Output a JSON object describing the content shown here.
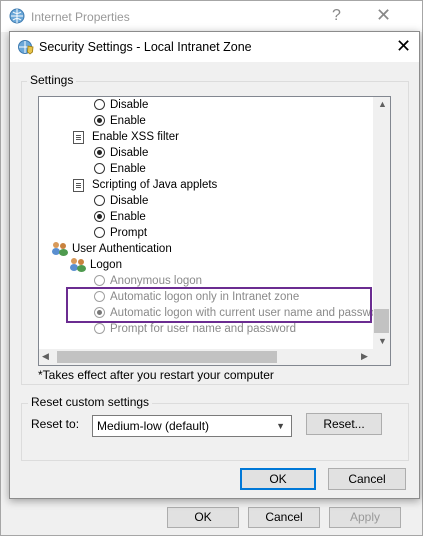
{
  "background_window": {
    "title": "Internet Properties",
    "help_label": "?",
    "close_label": "✕",
    "ok_label": "OK",
    "cancel_label": "Cancel",
    "apply_label": "Apply"
  },
  "dialog": {
    "title": "Security Settings - Local Intranet Zone",
    "close_label": "✕",
    "settings_label": "Settings",
    "footnote": "*Takes effect after you restart your computer",
    "reset_group_label": "Reset custom settings",
    "reset_to_label": "Reset to:",
    "reset_select_value": "Medium-low (default)",
    "reset_button_label": "Reset...",
    "ok_label": "OK",
    "cancel_label": "Cancel"
  },
  "tree": {
    "items": [
      {
        "type": "radio",
        "label": "Disable",
        "checked": false
      },
      {
        "type": "radio",
        "label": "Enable",
        "checked": true
      },
      {
        "type": "group",
        "label": "Enable XSS filter"
      },
      {
        "type": "radio",
        "label": "Disable",
        "checked": true
      },
      {
        "type": "radio",
        "label": "Enable",
        "checked": false
      },
      {
        "type": "group",
        "label": "Scripting of Java applets"
      },
      {
        "type": "radio",
        "label": "Disable",
        "checked": false
      },
      {
        "type": "radio",
        "label": "Enable",
        "checked": true
      },
      {
        "type": "radio",
        "label": "Prompt",
        "checked": false
      },
      {
        "type": "category",
        "label": "User Authentication"
      },
      {
        "type": "subcategory",
        "label": "Logon"
      },
      {
        "type": "radio",
        "label": "Anonymous logon",
        "checked": false
      },
      {
        "type": "radio",
        "label": "Automatic logon only in Intranet zone",
        "checked": false
      },
      {
        "type": "radio",
        "label": "Automatic logon with current user name and password",
        "checked": true
      },
      {
        "type": "radio",
        "label": "Prompt for user name and password",
        "checked": false
      }
    ]
  },
  "icons": {
    "globe": "globe-shield-icon",
    "document": "settings-document-icon",
    "users": "users-icon"
  },
  "colors": {
    "highlight_border": "#6b2c91",
    "focus_button_border": "#0078d7",
    "dialog_background": "#f0f0f0"
  }
}
